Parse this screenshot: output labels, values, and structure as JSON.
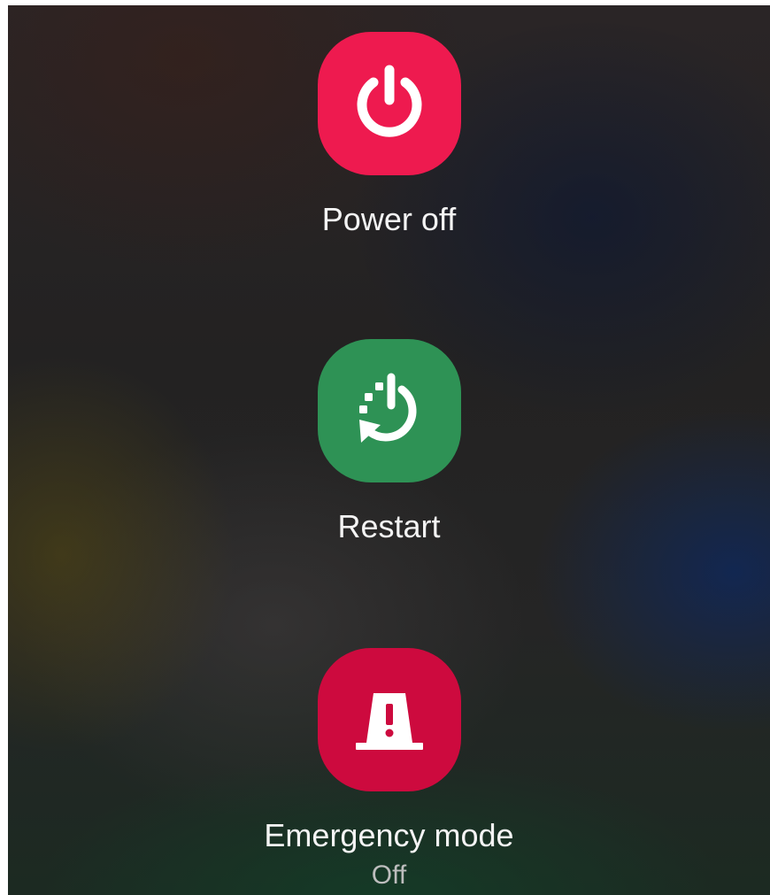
{
  "power_menu": {
    "power_off": {
      "label": "Power off",
      "icon": "power-icon",
      "color": "#ee1a4f"
    },
    "restart": {
      "label": "Restart",
      "icon": "restart-icon",
      "color": "#2e9255"
    },
    "emergency_mode": {
      "label": "Emergency mode",
      "status": "Off",
      "icon": "emergency-beacon-icon",
      "color": "#cd0a3e"
    }
  }
}
